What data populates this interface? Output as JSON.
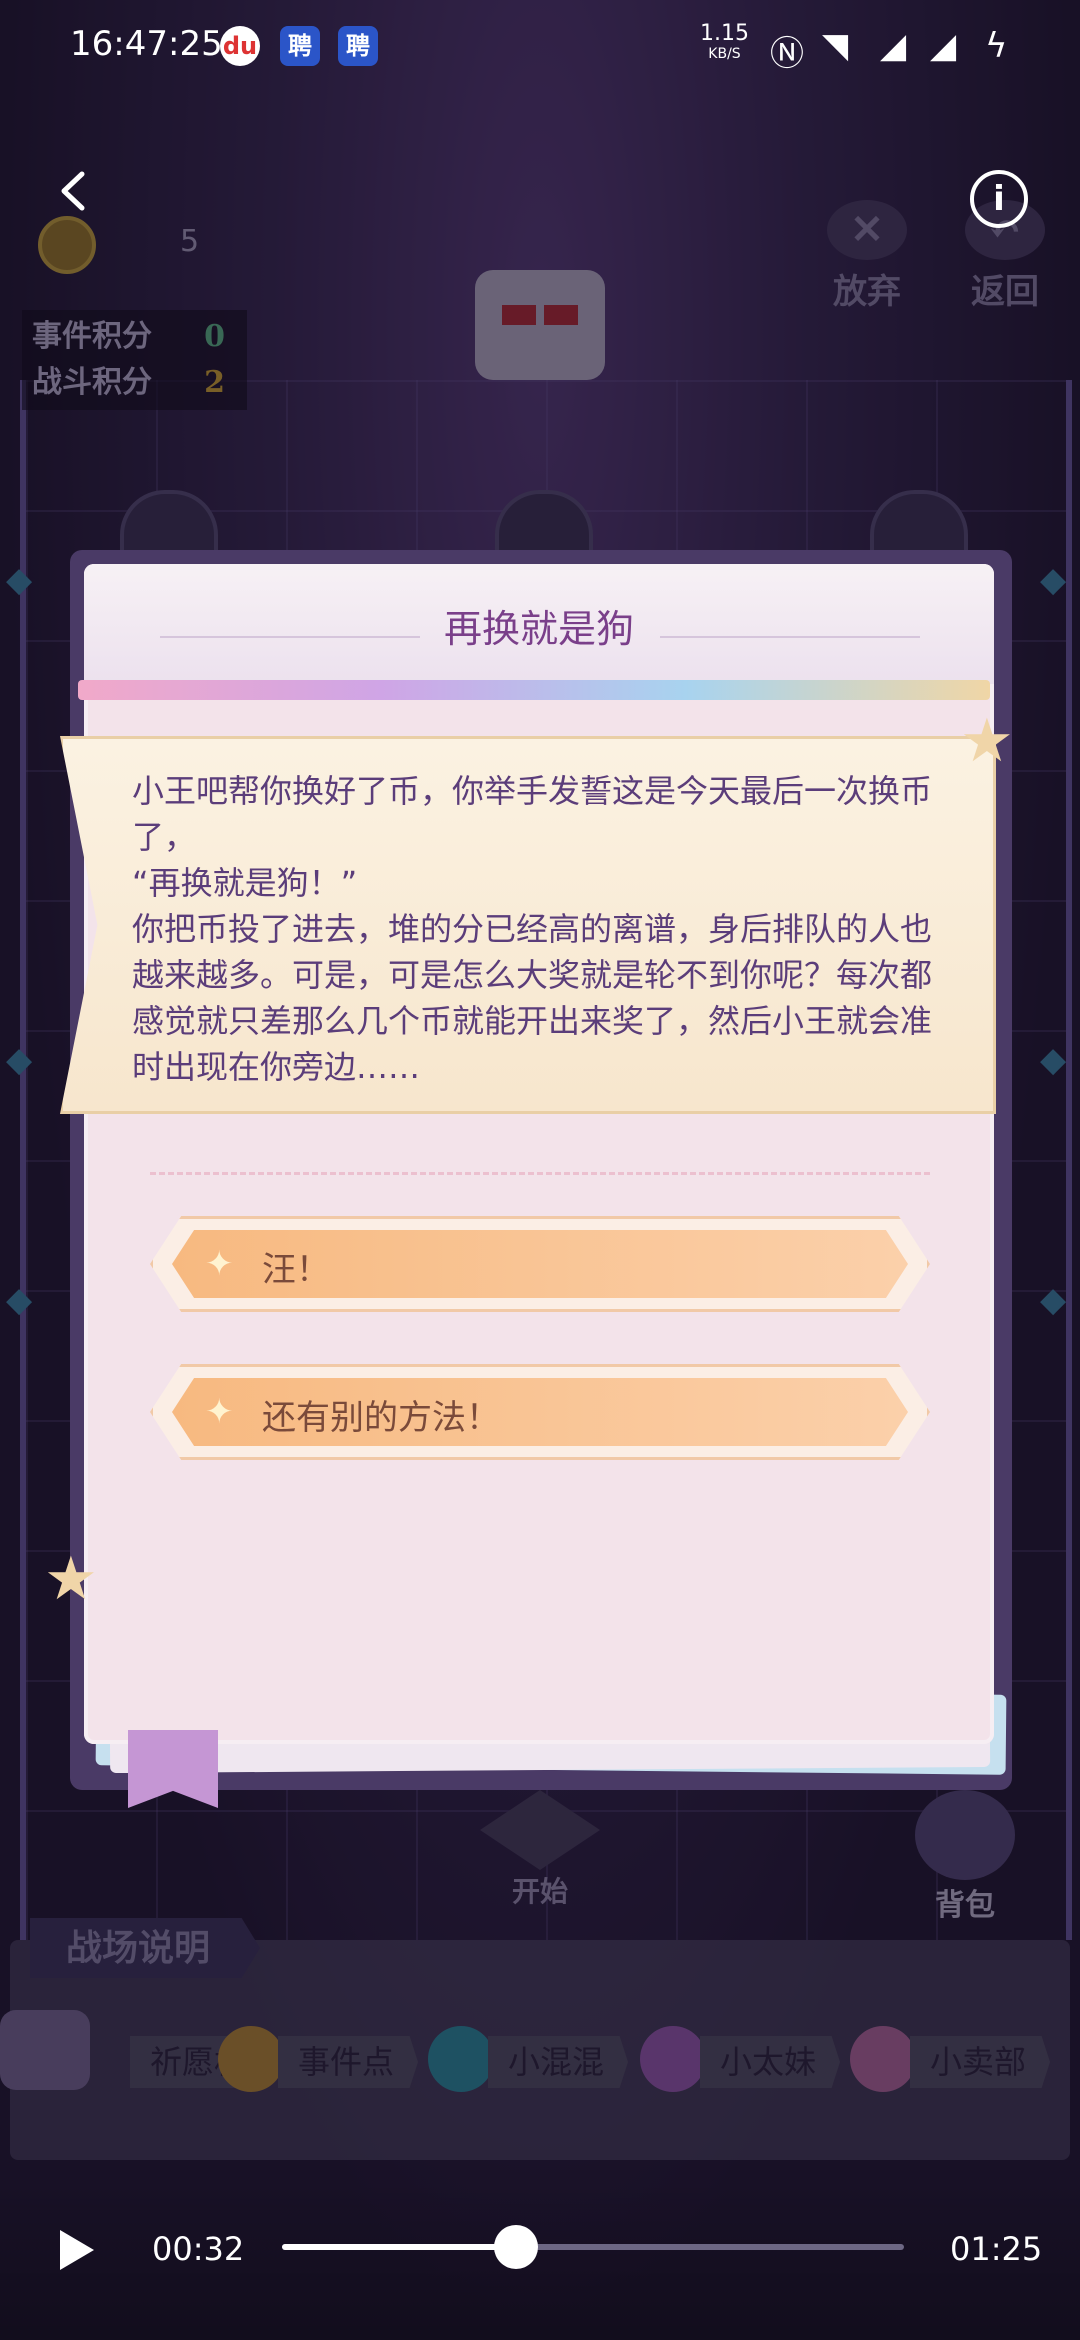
{
  "status_bar": {
    "time": "16:47:25",
    "app_icons": [
      "du",
      "聘",
      "聘"
    ],
    "net_speed_value": "1.15",
    "net_speed_unit": "KB/S",
    "icons": [
      "nfc-icon",
      "wifi-icon",
      "signal-4g-icon",
      "signal-4g-icon",
      "charging-icon"
    ]
  },
  "hud": {
    "coin_count": "5",
    "scores": [
      {
        "label": "事件积分",
        "value": "0"
      },
      {
        "label": "战斗积分",
        "value": "2"
      }
    ],
    "abandon_label": "放弃",
    "return_label": "返回"
  },
  "dialog": {
    "title": "再换就是狗",
    "story": "小王吧帮你换好了币，你举手发誓这是今天最后一次换币了，\n“再换就是狗！”\n你把币投了进去，堆的分已经高的离谱，身后排队的人也越来越多。可是，可是怎么大奖就是轮不到你呢？每次都感觉就只差那么几个币就能开出来奖了，然后小王就会准时出现在你旁边……",
    "choices": [
      {
        "label": "汪！"
      },
      {
        "label": "还有别的方法！"
      }
    ]
  },
  "board": {
    "start_label": "开始",
    "bag_label": "背包"
  },
  "legend": {
    "title": "战场说明",
    "items": [
      {
        "label": "祈愿机",
        "color": "#6b5f8c"
      },
      {
        "label": "事件点",
        "color": "#b98a3a"
      },
      {
        "label": "小混混",
        "color": "#2f8fa3"
      },
      {
        "label": "小太妹",
        "color": "#9a5bb3"
      },
      {
        "label": "小卖部",
        "color": "#b46aa0"
      }
    ]
  },
  "player": {
    "current_time": "00:32",
    "total_time": "01:25",
    "progress": 0.376
  }
}
